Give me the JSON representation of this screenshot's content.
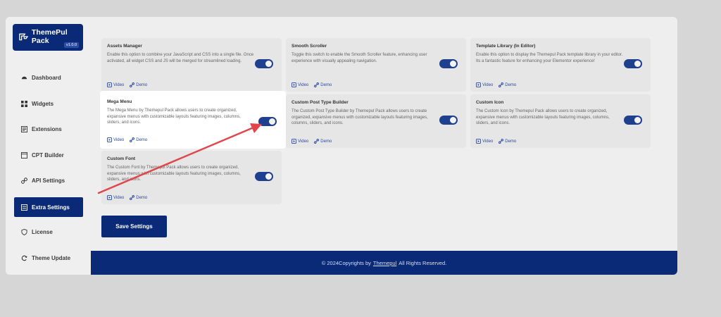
{
  "logo": {
    "name": "ThemePul Pack",
    "version": "v1.0.0",
    "icon": "themepul-logo-icon"
  },
  "sidebar": {
    "items": [
      {
        "label": "Dashboard",
        "icon": "dashboard-icon"
      },
      {
        "label": "Widgets",
        "icon": "widgets-icon"
      },
      {
        "label": "Extensions",
        "icon": "extensions-icon"
      },
      {
        "label": "CPT Builder",
        "icon": "cpt-builder-icon"
      },
      {
        "label": "API Settings",
        "icon": "link-icon"
      },
      {
        "label": "Extra Settings",
        "icon": "extra-settings-icon",
        "active": true
      },
      {
        "label": "License",
        "icon": "license-icon"
      },
      {
        "label": "Theme Update",
        "icon": "refresh-icon"
      }
    ]
  },
  "cards": [
    {
      "title": "Assets Manager",
      "desc": "Enable this option to combine your JavaScript and CSS into a single file. Once activated, all widget CSS and JS will be merged for streamlined loading.",
      "enabled": true
    },
    {
      "title": "Smooth Scroller",
      "desc": "Toggle this switch to enable the Smooth Scroller feature, enhancing user experience with visually appealing navigation.",
      "enabled": true
    },
    {
      "title": "Template Library (In Editor)",
      "desc": "Enable this option to display the Themepul Pack template library in your editor. Its a fantastic feature for enhancing your Elementor experience!",
      "enabled": true
    },
    {
      "title": "Mega Menu",
      "desc": "The Mega Menu by Themepul Pack allows users to create organized, expansive menus with customizable layouts featuring images, columns, sliders, and icons.",
      "enabled": true,
      "highlighted": true
    },
    {
      "title": "Custom Post Type Builder",
      "desc": "The Custom Post Type Builder by Themepul Pack allows users to create organized, expansive menus with customizable layouts featuring images, columns, sliders, and icons.",
      "enabled": true
    },
    {
      "title": "Custom Icon",
      "desc": "The Custom Icon by Themepul Pack allows users to create organized, expansive menus with customizable layouts featuring images, columns, sliders, and icons.",
      "enabled": true
    },
    {
      "title": "Custom Font",
      "desc": "The Custom Font by Themepul Pack allows users to create organized, expansive menus with customizable layouts featuring images, columns, sliders, and icons.",
      "enabled": true
    }
  ],
  "links": {
    "video": "Video",
    "demo": "Demo"
  },
  "save_label": "Save Settings",
  "footer": {
    "prefix": "© 2024Copyrights by",
    "brand": "Themepul",
    "suffix": "All Rights Reserved."
  },
  "colors": {
    "brand": "#0a2a78",
    "toggle_on": "#1f3f8f",
    "annotation_arrow": "#e2464b"
  }
}
